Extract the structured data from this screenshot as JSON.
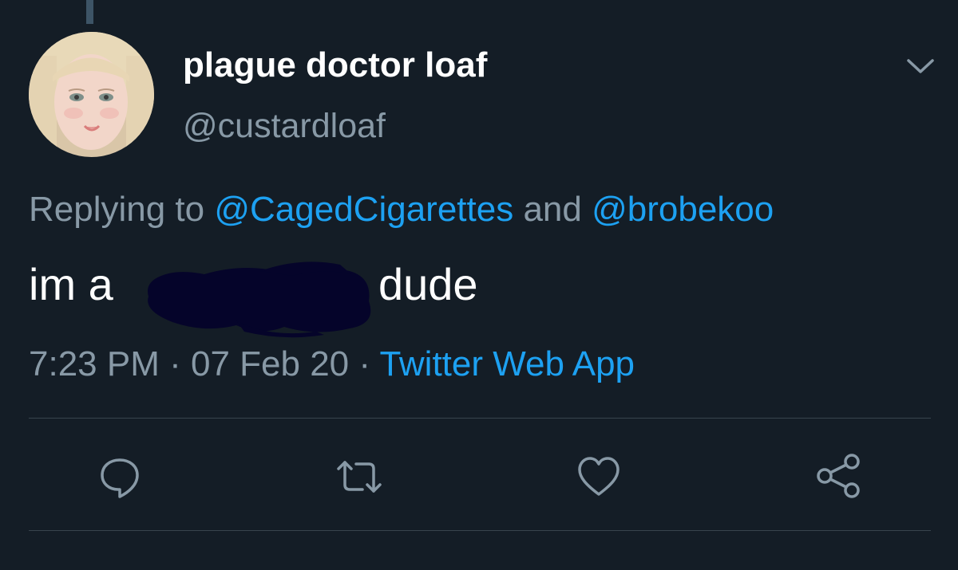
{
  "tweet": {
    "display_name": "plague doctor loaf",
    "handle": "@custardloaf",
    "replying_prefix": "Replying to ",
    "mention_1": "@CagedCigarettes",
    "replying_join": " and ",
    "mention_2": "@brobekoo",
    "text_before": "im a",
    "text_after": "dude",
    "time": "7:23 PM",
    "date": "07 Feb 20",
    "separator": " · ",
    "source": "Twitter Web App"
  },
  "actions": [
    {
      "icon": "reply-icon"
    },
    {
      "icon": "retweet-icon"
    },
    {
      "icon": "like-icon"
    },
    {
      "icon": "share-icon"
    }
  ],
  "colors": {
    "background": "#141d26",
    "primary_text": "#ffffff",
    "secondary_text": "#8899a6",
    "link": "#1da1f2",
    "divider": "#38444d",
    "redaction": "#05042a"
  }
}
